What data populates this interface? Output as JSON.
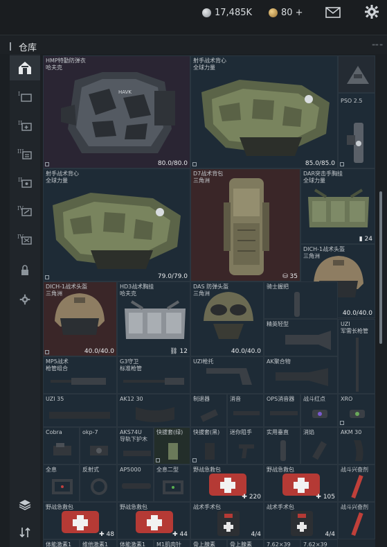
{
  "topbar": {
    "silver_amount": "17,485K",
    "gold_amount": "80 +",
    "mail_icon": "mail-icon",
    "settings_icon": "gear-icon",
    "silver_color": "#b8bcc0",
    "gold_color": "#c8a060"
  },
  "header": {
    "title": "仓库"
  },
  "sidebar": {
    "items": [
      {
        "icon": "home-icon",
        "active": true
      },
      {
        "icon": "storage-1-icon",
        "label": "I"
      },
      {
        "icon": "storage-2-icon",
        "label": "II"
      },
      {
        "icon": "storage-3-icon",
        "label": "III"
      },
      {
        "icon": "storage-4-icon",
        "label": "II"
      },
      {
        "icon": "storage-5-icon",
        "label": "IV"
      },
      {
        "icon": "storage-6-icon",
        "label": "IV"
      },
      {
        "icon": "lock-icon"
      },
      {
        "icon": "gear-icon"
      },
      {
        "icon": "layers-icon"
      },
      {
        "icon": "sort-icon"
      }
    ]
  },
  "items": {
    "hmp_vest": {
      "name": "HMP特勤防弹衣\n哈夫克",
      "count": "80.0/80.0",
      "patch": "HAVK"
    },
    "shooter_vest_a": {
      "name": "射手战术背心\n全球力量",
      "count": "85.0/85.0"
    },
    "pso": {
      "name": "PSO 2.5"
    },
    "shooter_vest_b": {
      "name": "射手战术背心\n全球力量",
      "count": "79.0/79.0"
    },
    "d7_pack": {
      "name": "D7战术背包\n三角洲",
      "count": "35"
    },
    "dar_rig": {
      "name": "DAR突击手胸挂\n全球力量",
      "count": "24"
    },
    "dich_helmet_a": {
      "name": "DICH-1战术头盔\n三角洲",
      "count": "40.0/40.0"
    },
    "dich_helmet_b": {
      "name": "DICH-1战术头盔\n三角洲",
      "count": "40.0/40.0"
    },
    "hd3_rig": {
      "name": "HD3战术胸挂\n哈夫克",
      "count": "12"
    },
    "das_helmet": {
      "name": "DAS 防弹头盔\n三角洲",
      "count": "40.0/40.0"
    },
    "knight_grip": {
      "name": "骑士握把"
    },
    "elite_light": {
      "name": "精英轻型"
    },
    "uzi_stock": {
      "name": "UZI\n军需长枪管"
    },
    "mp5_kit": {
      "name": "MP5战术\n枪管组合"
    },
    "g3_guard": {
      "name": "G3守卫\n标准枪管"
    },
    "uzi_stock2": {
      "name": "UZI枪托"
    },
    "ak_poly": {
      "name": "AK聚合物"
    },
    "uzi35": {
      "name": "UZI 35"
    },
    "ak12_30": {
      "name": "AK12 30"
    },
    "suppressor": {
      "name": "制退器"
    },
    "silencer": {
      "name": "消音"
    },
    "ops_silencer": {
      "name": "OPS消音器"
    },
    "combat_red": {
      "name": "战斗红点"
    },
    "xro": {
      "name": "XRO"
    },
    "cobra": {
      "name": "Cobra"
    },
    "okp7": {
      "name": "okp-7"
    },
    "aks74u": {
      "name": "AKS74U\n导轨下护木"
    },
    "quick_green": {
      "name": "快拔套(绿)"
    },
    "quick_black": {
      "name": "快拔套(黑)"
    },
    "mini_stock": {
      "name": "迷你阻手"
    },
    "practical_grip": {
      "name": "实用垂直"
    },
    "flash": {
      "name": "消焰"
    },
    "akm30": {
      "name": "AKM 30"
    },
    "holo": {
      "name": "全息"
    },
    "reflex": {
      "name": "反射式"
    },
    "ap5000": {
      "name": "AP5000"
    },
    "holo2": {
      "name": "全息二型"
    },
    "medkit_a": {
      "name": "野战急救包",
      "count": "220"
    },
    "medkit_b": {
      "name": "野战急救包",
      "count": "105"
    },
    "stim_a": {
      "name": "战斗兴奋剂"
    },
    "medkit_c": {
      "name": "野战急救包",
      "count": "48"
    },
    "medkit_d": {
      "name": "野战急救包",
      "count": "44"
    },
    "surgery_a": {
      "name": "战术手术包",
      "count": "4/4"
    },
    "surgery_b": {
      "name": "战术手术包",
      "count": "4/4"
    },
    "stim_b": {
      "name": "战斗兴奋剂"
    }
  },
  "bottom_row": [
    "体能激素1",
    "维他激素1",
    "体能激素1",
    "M1肌肉针",
    "骨上腺素",
    "骨上腺素",
    "7.62×39",
    "7.62×39"
  ],
  "colors": {
    "cell_blue": "#1e2b36",
    "cell_red": "#3a2628",
    "cell_purple": "#2a2533",
    "cell_dark": "#242b33"
  }
}
